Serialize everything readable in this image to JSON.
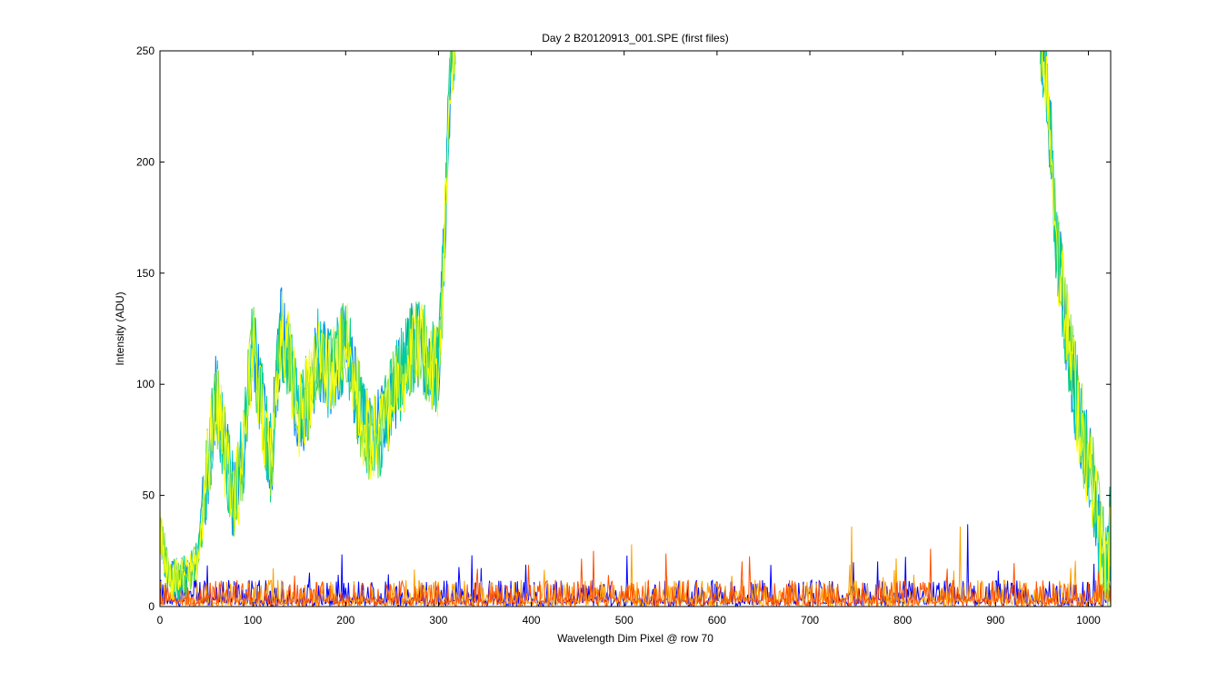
{
  "chart_data": {
    "type": "line",
    "title": "Day 2  B20120913_001.SPE (first files)",
    "xlabel": "Wavelength Dim Pixel @ row 70",
    "ylabel": "Intensity (ADU)",
    "xlim": [
      0,
      1024
    ],
    "ylim": [
      0,
      250
    ],
    "xticks": [
      0,
      100,
      200,
      300,
      400,
      500,
      600,
      700,
      800,
      900,
      1000
    ],
    "yticks": [
      0,
      50,
      100,
      150,
      200,
      250
    ],
    "grid": false,
    "legend": "none",
    "series_colors": [
      "#0000ff",
      "#0080ff",
      "#00c8c8",
      "#00d080",
      "#80e040",
      "#ffff00",
      "#ffa000",
      "#ff5000"
    ],
    "bright_envelope": {
      "x": [
        0,
        10,
        20,
        30,
        40,
        50,
        60,
        70,
        80,
        90,
        100,
        110,
        120,
        130,
        140,
        150,
        160,
        170,
        180,
        190,
        200,
        210,
        220,
        230,
        240,
        250,
        260,
        270,
        280,
        290,
        300,
        305,
        310,
        315,
        318
      ],
      "y": [
        35,
        12,
        12,
        15,
        20,
        55,
        95,
        70,
        45,
        70,
        120,
        90,
        65,
        125,
        110,
        85,
        95,
        115,
        105,
        110,
        120,
        100,
        80,
        75,
        80,
        95,
        105,
        115,
        120,
        110,
        105,
        150,
        210,
        250,
        260
      ]
    },
    "bright_envelope_right": {
      "x": [
        948,
        955,
        960,
        965,
        970,
        975,
        980,
        985,
        990,
        995,
        1000,
        1005,
        1010,
        1015,
        1020,
        1024
      ],
      "y": [
        260,
        240,
        205,
        170,
        150,
        130,
        115,
        100,
        85,
        75,
        65,
        55,
        40,
        25,
        15,
        40
      ]
    },
    "noise_floor": {
      "typical_max": 10,
      "peaks": [
        {
          "x": 467,
          "y": 25
        },
        {
          "x": 508,
          "y": 28
        },
        {
          "x": 745,
          "y": 36
        },
        {
          "x": 862,
          "y": 36
        },
        {
          "x": 870,
          "y": 37
        },
        {
          "x": 830,
          "y": 26
        }
      ]
    }
  }
}
